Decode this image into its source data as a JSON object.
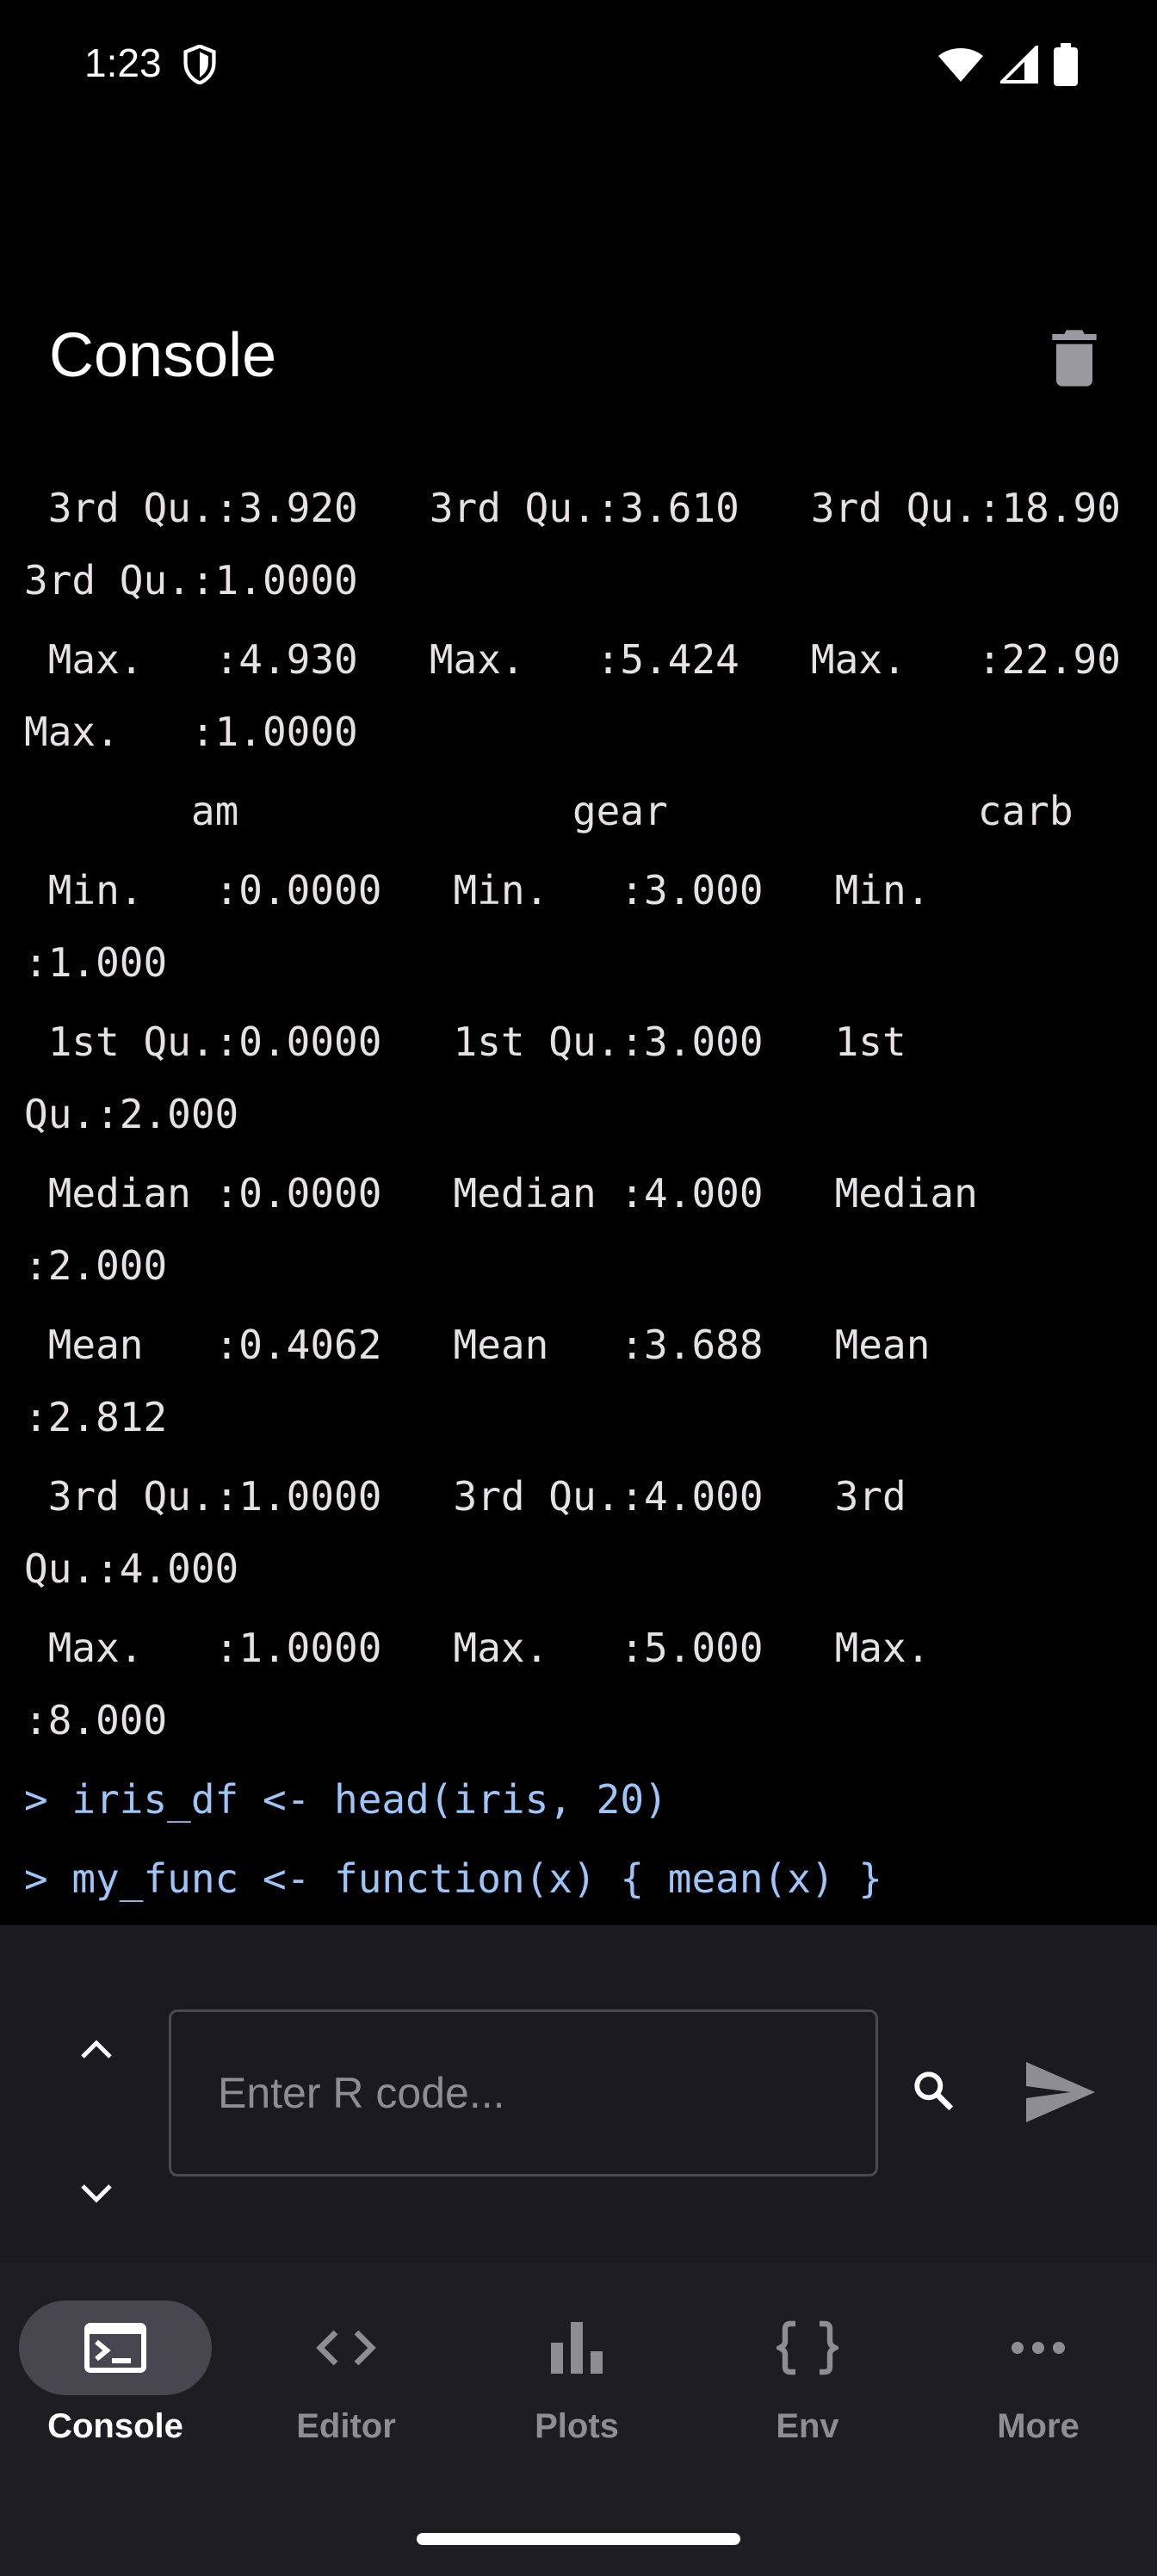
{
  "status_bar": {
    "time": "1:23"
  },
  "header": {
    "title": "Console"
  },
  "console": {
    "lines": [
      {
        "text": " 3rd Qu.:3.920   3rd Qu.:3.610   3rd Qu.:18.90   3rd Qu.:1.0000",
        "kind": "output"
      },
      {
        "text": " Max.   :4.930   Max.   :5.424   Max.   :22.90   Max.   :1.0000",
        "kind": "output"
      },
      {
        "text": "       am              gear             carb",
        "kind": "output"
      },
      {
        "text": " Min.   :0.0000   Min.   :3.000   Min.   :1.000",
        "kind": "output"
      },
      {
        "text": " 1st Qu.:0.0000   1st Qu.:3.000   1st Qu.:2.000",
        "kind": "output"
      },
      {
        "text": " Median :0.0000   Median :4.000   Median :2.000",
        "kind": "output"
      },
      {
        "text": " Mean   :0.4062   Mean   :3.688   Mean   :2.812",
        "kind": "output"
      },
      {
        "text": " 3rd Qu.:1.0000   3rd Qu.:4.000   3rd Qu.:4.000",
        "kind": "output"
      },
      {
        "text": " Max.   :1.0000   Max.   :5.000   Max.   :8.000",
        "kind": "output"
      },
      {
        "text": "> iris_df <- head(iris, 20)",
        "kind": "command"
      },
      {
        "text": "> my_func <- function(x) { mean(x) }",
        "kind": "command"
      }
    ]
  },
  "input": {
    "placeholder": "Enter R code...",
    "value": ""
  },
  "nav": {
    "items": [
      {
        "label": "Console",
        "icon": "terminal-icon",
        "active": true
      },
      {
        "label": "Editor",
        "icon": "code-icon",
        "active": false
      },
      {
        "label": "Plots",
        "icon": "bar-chart-icon",
        "active": false
      },
      {
        "label": "Env",
        "icon": "braces-icon",
        "active": false
      },
      {
        "label": "More",
        "icon": "more-horiz-icon",
        "active": false
      }
    ]
  },
  "colors": {
    "background": "#000000",
    "command_text": "#9ec5f8",
    "output_text": "#e6e1e5",
    "input_bar": "#1b1b1f",
    "nav_bar": "#1e1e22",
    "active_pill": "#48464f",
    "inactive_label": "#8f8d94"
  }
}
